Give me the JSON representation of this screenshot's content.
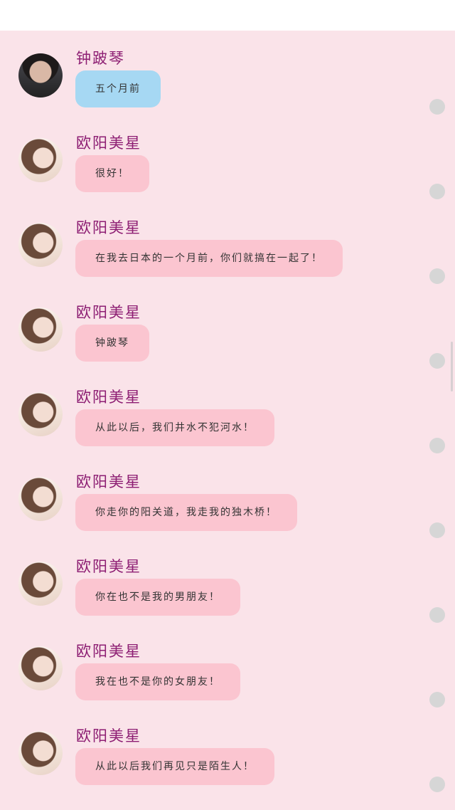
{
  "messages": [
    {
      "sender": "钟跛琴",
      "text": "五个月前",
      "avatar": "male-avatar",
      "bubble_color": "#a6d8f3"
    },
    {
      "sender": "欧阳美星",
      "text": "很好！",
      "avatar": "female-avatar",
      "bubble_color": "#fbc5d0"
    },
    {
      "sender": "欧阳美星",
      "text": "在我去日本的一个月前，你们就搞在一起了！",
      "avatar": "female-avatar",
      "bubble_color": "#fbc5d0"
    },
    {
      "sender": "欧阳美星",
      "text": "钟跛琴",
      "avatar": "female-avatar",
      "bubble_color": "#fbc5d0"
    },
    {
      "sender": "欧阳美星",
      "text": "从此以后，我们井水不犯河水！",
      "avatar": "female-avatar",
      "bubble_color": "#fbc5d0"
    },
    {
      "sender": "欧阳美星",
      "text": "你走你的阳关道，我走我的独木桥！",
      "avatar": "female-avatar",
      "bubble_color": "#fbc5d0"
    },
    {
      "sender": "欧阳美星",
      "text": "你在也不是我的男朋友！",
      "avatar": "female-avatar",
      "bubble_color": "#fbc5d0"
    },
    {
      "sender": "欧阳美星",
      "text": "我在也不是你的女朋友！",
      "avatar": "female-avatar",
      "bubble_color": "#fbc5d0"
    },
    {
      "sender": "欧阳美星",
      "text": "从此以后我们再见只是陌生人！",
      "avatar": "female-avatar",
      "bubble_color": "#fbc5d0"
    }
  ],
  "colors": {
    "background": "#fae3e9",
    "sender_name": "#8d1e73",
    "bubble_pink": "#fbc5d0",
    "bubble_blue": "#a6d8f3",
    "status_dot": "#d6d6d6"
  }
}
